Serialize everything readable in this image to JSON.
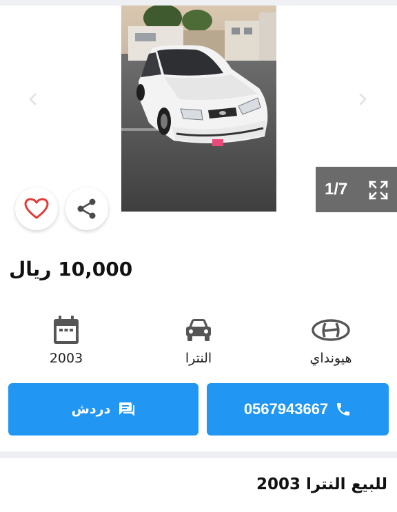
{
  "gallery": {
    "counter": "1/7",
    "current_index": 1,
    "total_images": 7
  },
  "listing": {
    "price": "10,000 ريال",
    "title": "للبيع النترا 2003"
  },
  "specs": {
    "year": "2003",
    "model": "النترا",
    "brand": "هيونداي"
  },
  "actions": {
    "chat_label": "دردش",
    "phone": "0567943667"
  },
  "colors": {
    "accent": "#2196f3",
    "heart": "#e53935",
    "counter_bg": "#6b6b6b",
    "icon_gray": "#555555"
  },
  "icons": {
    "prev": "chevron-left-icon",
    "next": "chevron-right-icon",
    "fullscreen": "expand-icon",
    "favorite": "heart-icon",
    "share": "share-icon",
    "year": "calendar-icon",
    "model": "car-icon",
    "brand": "hyundai-logo-icon",
    "chat": "chat-icon",
    "call": "phone-icon"
  }
}
